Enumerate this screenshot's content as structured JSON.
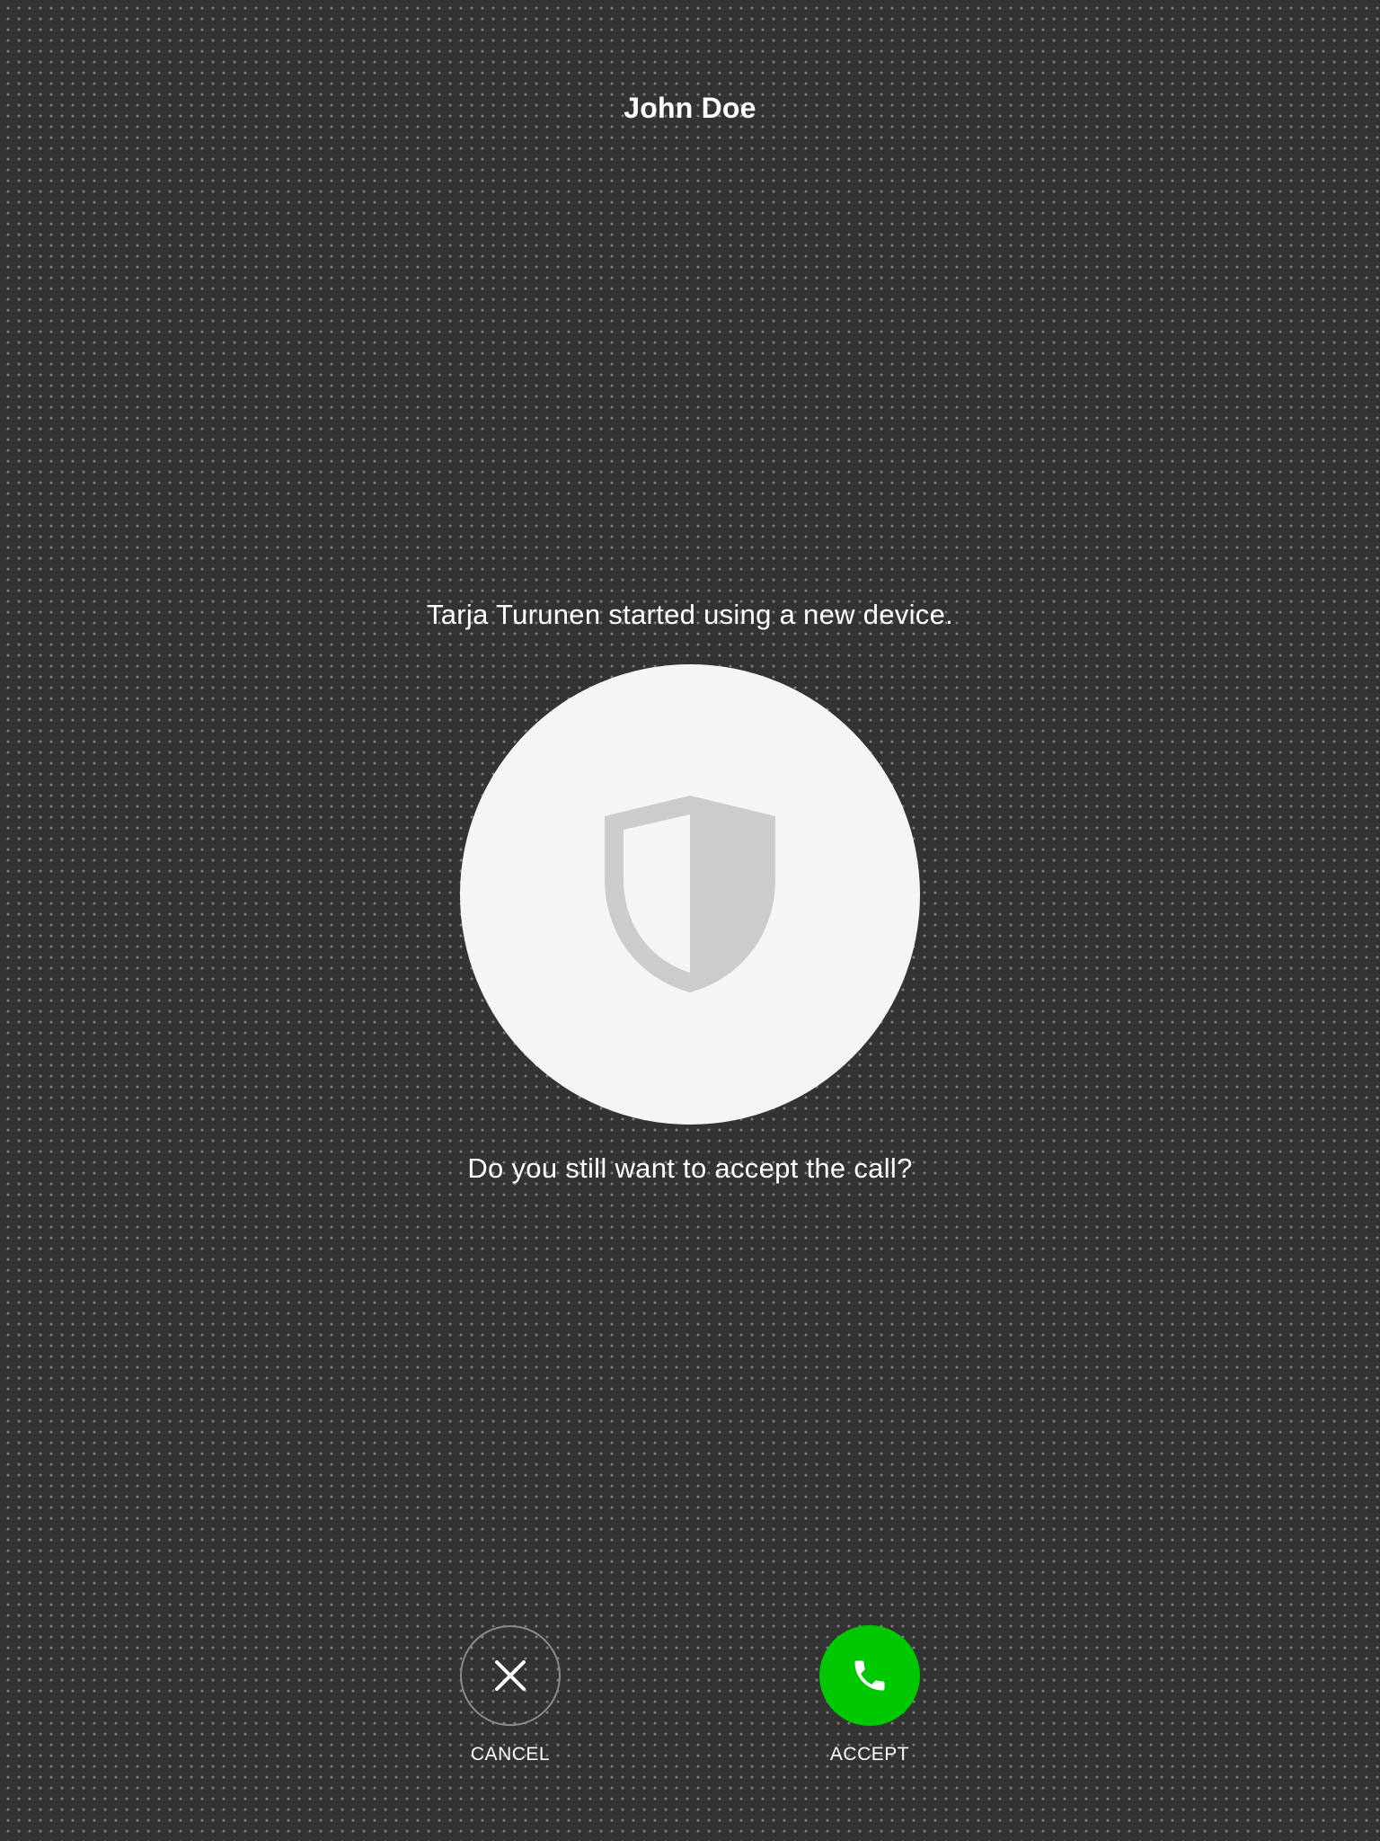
{
  "header": {
    "caller_name": "John Doe"
  },
  "verification": {
    "message": "Tarja Turunen started using a new device.",
    "icon": "shield-icon",
    "question": "Do you still want to accept the call?"
  },
  "actions": {
    "cancel": {
      "label": "CANCEL",
      "icon": "close-icon"
    },
    "accept": {
      "label": "ACCEPT",
      "icon": "phone-icon",
      "color": "#00c800"
    }
  },
  "colors": {
    "background": "#333333",
    "circle": "#f5f5f5",
    "shield": "#cccccc"
  }
}
